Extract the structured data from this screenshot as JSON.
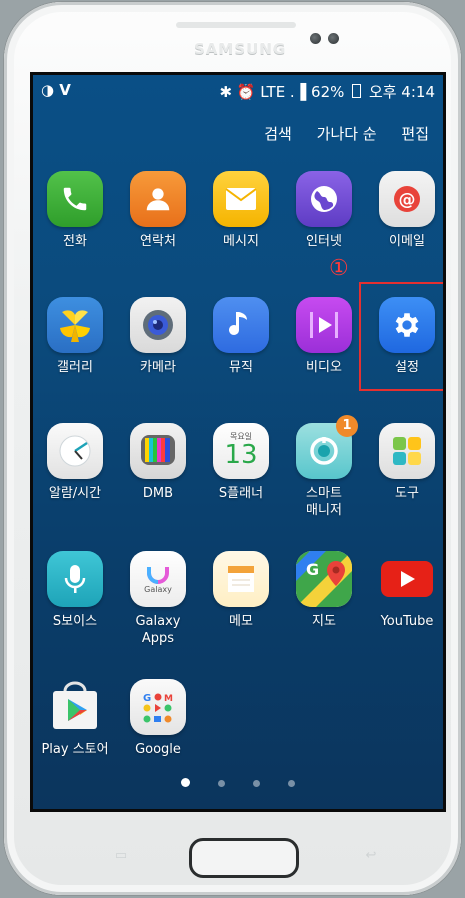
{
  "device": {
    "brand": "SAMSUNG"
  },
  "statusbar": {
    "left_icons": "◑ V",
    "right_icons": "✱ ⏰ LTE .▐",
    "battery": "62%",
    "time": "오후 4:14"
  },
  "menu": {
    "search": "검색",
    "sort": "가나다 순",
    "edit": "편집"
  },
  "annotation": {
    "step": "①"
  },
  "apps": [
    {
      "label": "전화"
    },
    {
      "label": "연락처"
    },
    {
      "label": "메시지"
    },
    {
      "label": "인터넷"
    },
    {
      "label": "이메일"
    },
    {
      "label": "갤러리"
    },
    {
      "label": "카메라"
    },
    {
      "label": "뮤직"
    },
    {
      "label": "비디오"
    },
    {
      "label": "설정"
    },
    {
      "label": "알람/시간"
    },
    {
      "label": "DMB"
    },
    {
      "label": "S플래너",
      "calendar_day": "13",
      "calendar_dow": "목요일"
    },
    {
      "label": "스마트\n매니저",
      "badge": "1"
    },
    {
      "label": "도구"
    },
    {
      "label": "S보이스"
    },
    {
      "label": "Galaxy Apps",
      "icon_text": "Galaxy"
    },
    {
      "label": "메모"
    },
    {
      "label": "지도"
    },
    {
      "label": "YouTube"
    },
    {
      "label": "Play 스토어"
    },
    {
      "label": "Google"
    }
  ],
  "colors": {
    "highlight": "#e53030",
    "badge": "#f08a2a"
  }
}
